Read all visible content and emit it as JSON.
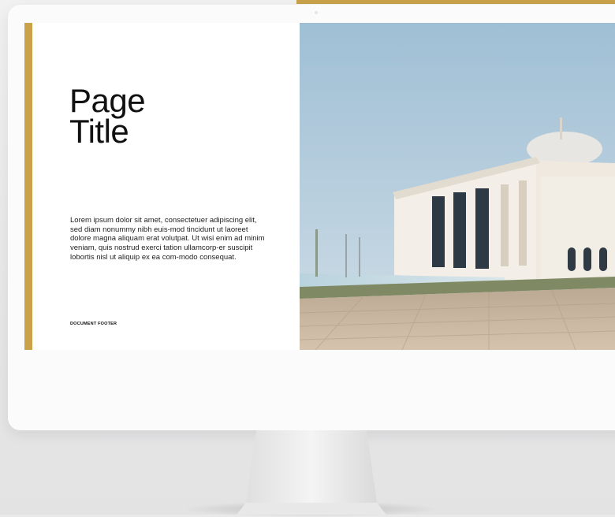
{
  "slide": {
    "title_line1": "Page",
    "title_line2": "Title",
    "body": "Lorem ipsum dolor sit amet, consectetuer adipiscing elit, sed diam nonummy nibh euis-mod tincidunt ut laoreet dolore magna aliquam erat volutpat. Ut wisi enim ad minim veniam, quis nostrud exerci tation ullamcorp-er suscipit lobortis nisl ut aliquip ex ea com-modo consequat.",
    "footer": "DOCUMENT FOOTER"
  },
  "colors": {
    "accent_gold": "#c9a24a",
    "sky": "#a9c6d8",
    "building": "#efe9e0",
    "paving": "#c9b7a1"
  },
  "icons": {
    "photo": "mosque-photo"
  }
}
